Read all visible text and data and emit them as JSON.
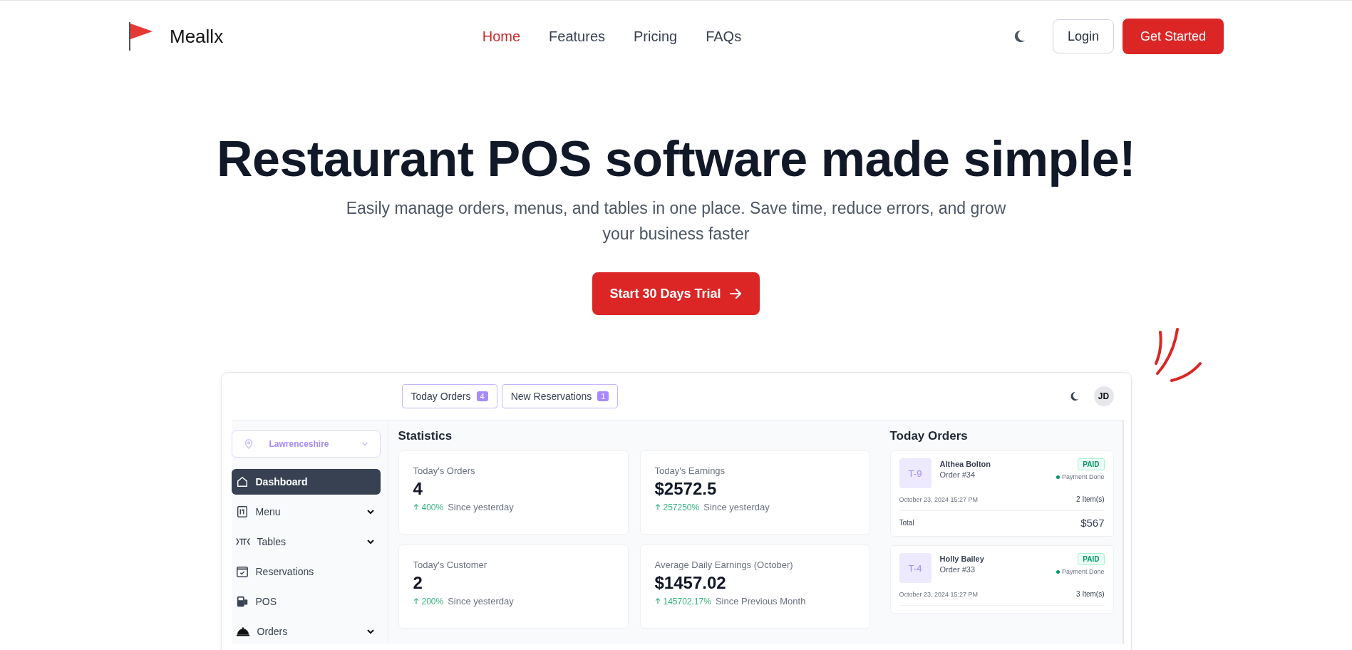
{
  "nav": {
    "brand": "Meallx",
    "links": [
      {
        "label": "Home",
        "selected": true
      },
      {
        "label": "Features",
        "selected": false
      },
      {
        "label": "Pricing",
        "selected": false
      },
      {
        "label": "FAQs",
        "selected": false
      }
    ],
    "login": "Login",
    "get_started": "Get Started"
  },
  "hero": {
    "title": "Restaurant POS software made simple!",
    "subtitle": "Easily manage orders, menus, and tables in one place. Save time, reduce errors, and grow your business faster",
    "cta": "Start 30 Days Trial"
  },
  "dashboard": {
    "tabs": [
      {
        "label": "Today Orders",
        "count": "4"
      },
      {
        "label": "New Reservations",
        "count": "1"
      }
    ],
    "avatar": "JD",
    "location": "Lawrenceshire",
    "sidebar": {
      "items": [
        {
          "label": "Dashboard",
          "kind": "home",
          "selected": true,
          "has_submenu": false
        },
        {
          "label": "Menu",
          "kind": "menu",
          "selected": false,
          "has_submenu": true
        },
        {
          "label": "Tables",
          "kind": "tables",
          "selected": false,
          "has_submenu": true
        },
        {
          "label": "Reservations",
          "kind": "calendar",
          "selected": false,
          "has_submenu": false
        },
        {
          "label": "POS",
          "kind": "pos",
          "selected": false,
          "has_submenu": false
        },
        {
          "label": "Orders",
          "kind": "cloche",
          "selected": false,
          "has_submenu": true
        }
      ]
    },
    "statistics_title": "Statistics",
    "stats": [
      {
        "label": "Today's Orders",
        "value": "4",
        "change": "400%",
        "caption": "Since yesterday"
      },
      {
        "label": "Today's Earnings",
        "value": "$2572.5",
        "change": "257250%",
        "caption": "Since yesterday"
      },
      {
        "label": "Today's Customer",
        "value": "2",
        "change": "200%",
        "caption": "Since yesterday"
      },
      {
        "label": "Average Daily Earnings (October)",
        "value": "$1457.02",
        "change": "145702.17%",
        "caption": "Since Previous Month"
      }
    ],
    "orders_title": "Today Orders",
    "orders": [
      {
        "table": "T-9",
        "name": "Althea Bolton",
        "order": "Order #34",
        "status": "PAID",
        "payment": "Payment Done",
        "date": "October 23, 2024 15:27 PM",
        "items": "2 Item(s)",
        "total_label": "Total",
        "total": "$567"
      },
      {
        "table": "T-4",
        "name": "Holly Bailey",
        "order": "Order #33",
        "status": "PAID",
        "payment": "Payment Done",
        "date": "October 23, 2024 15:27 PM",
        "items": "3 Item(s)"
      }
    ]
  }
}
